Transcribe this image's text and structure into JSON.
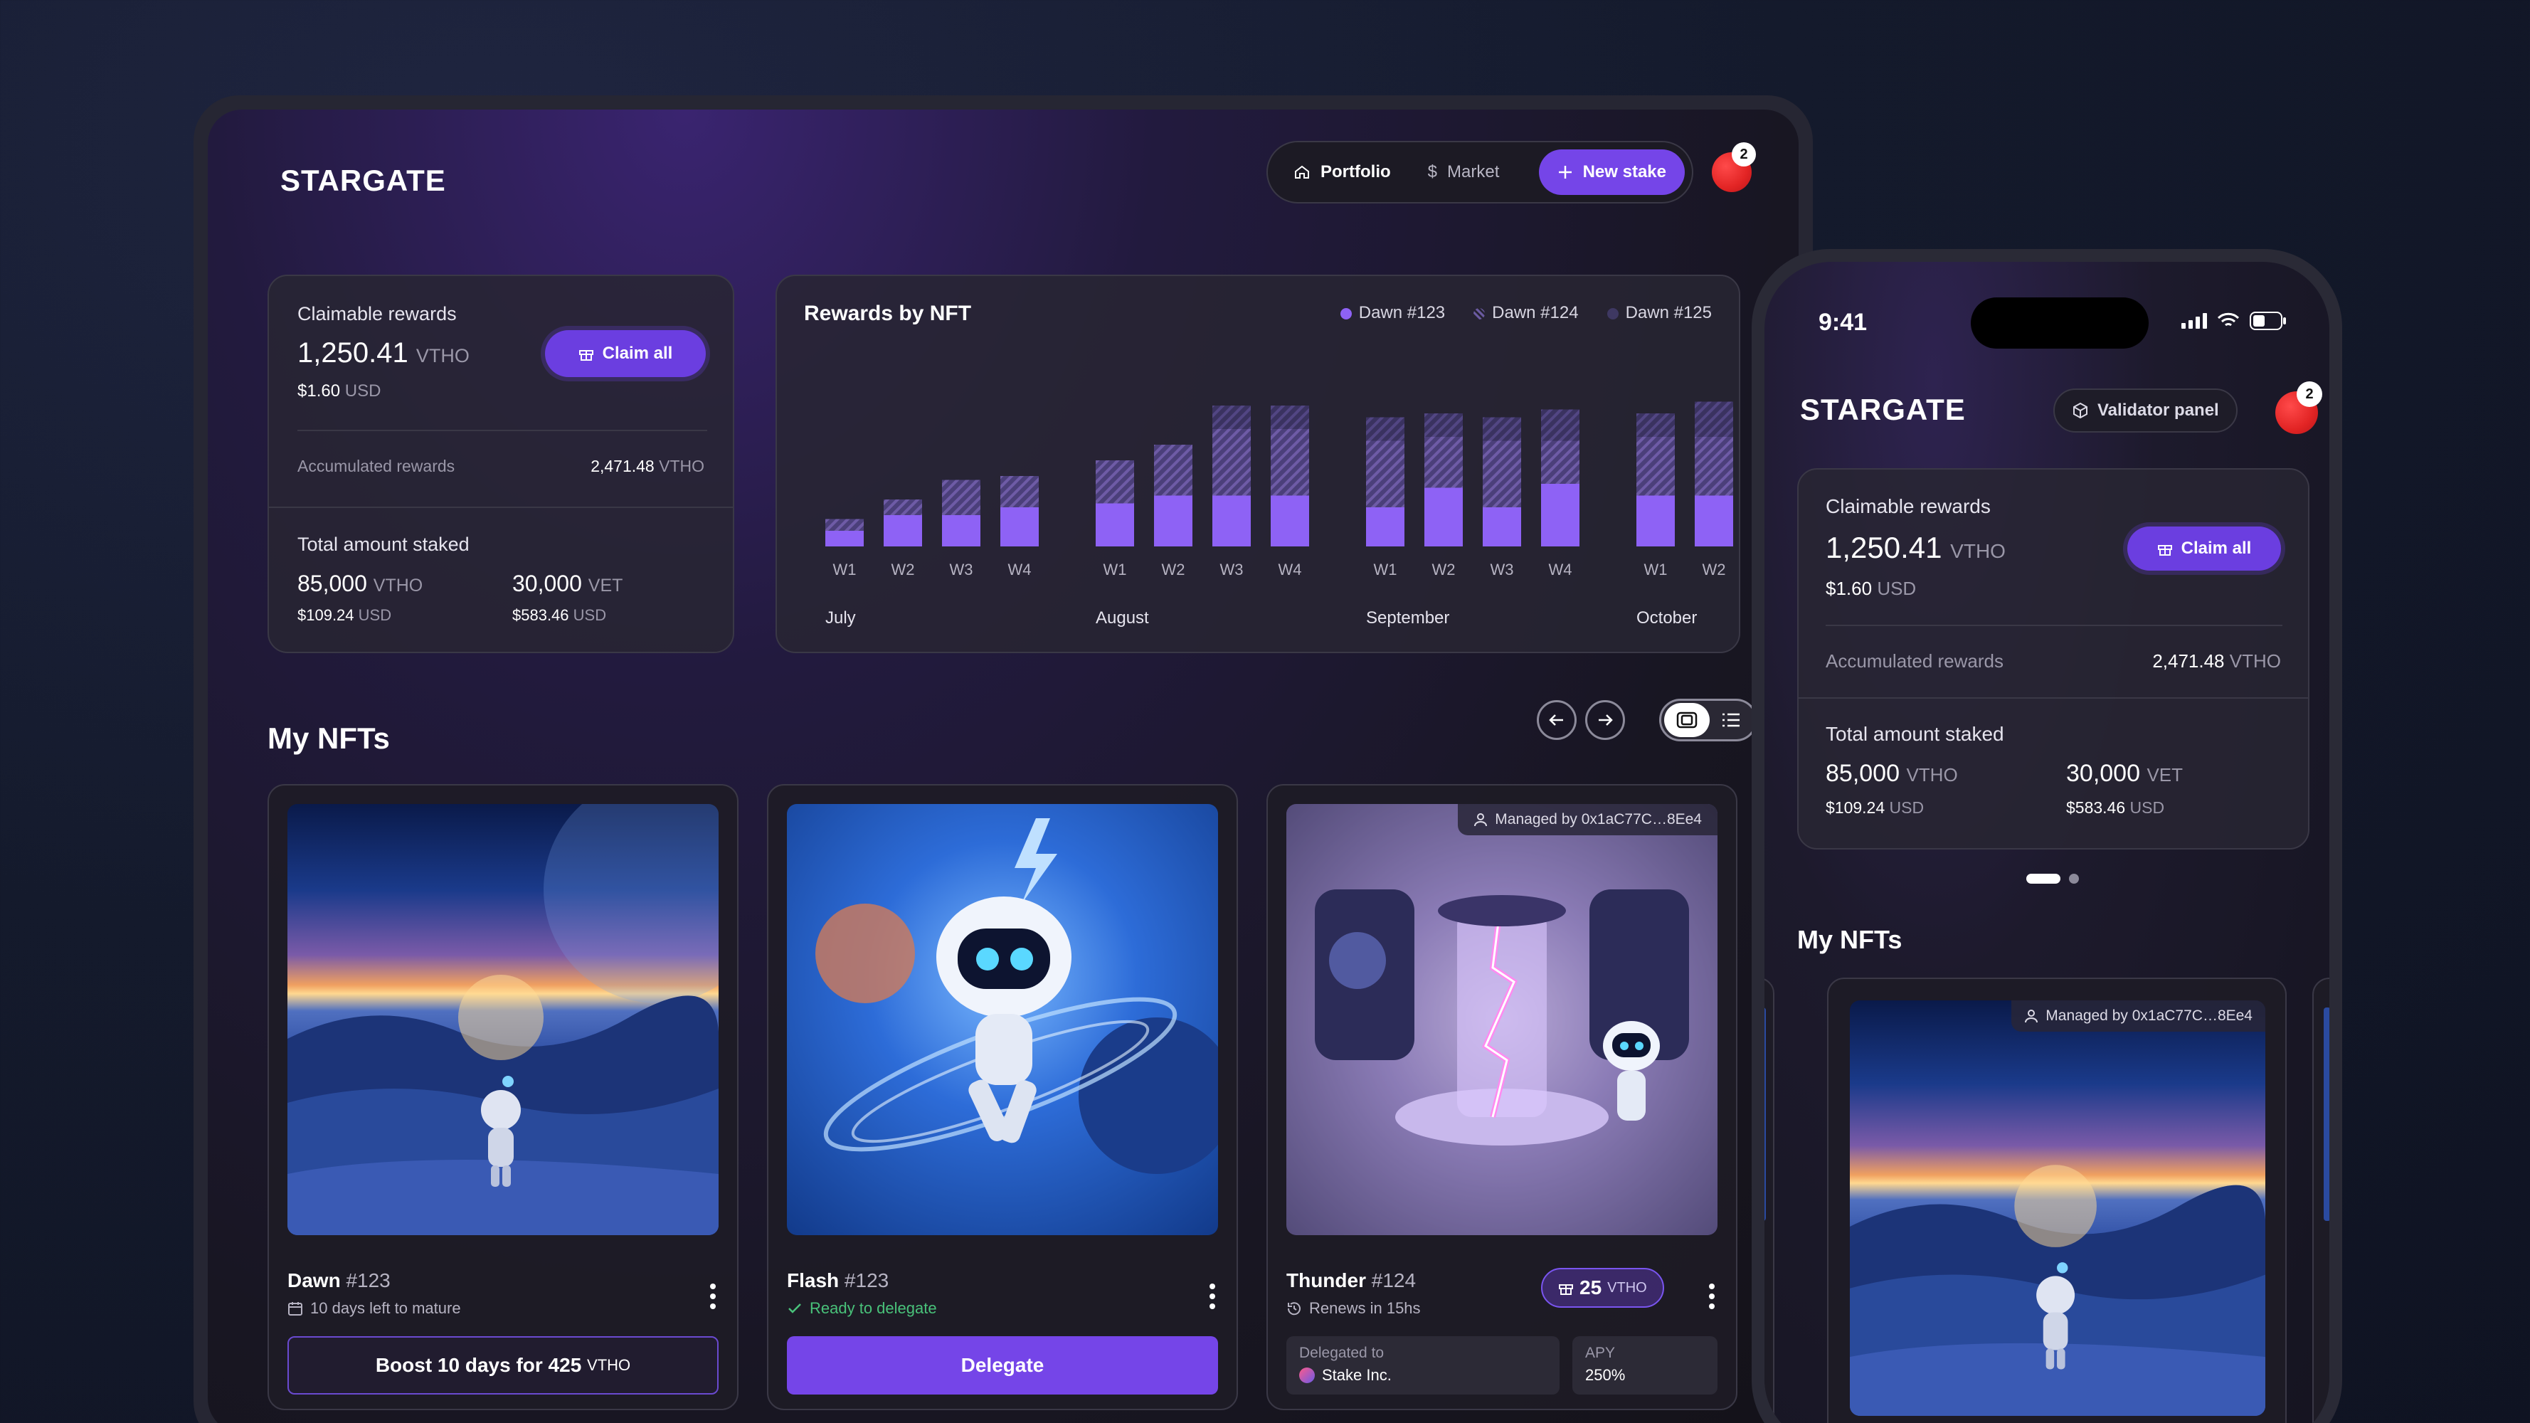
{
  "app": {
    "name": "STARGATE"
  },
  "nav": {
    "portfolio": "Portfolio",
    "market": "Market",
    "new_stake": "New stake",
    "notifications": "2"
  },
  "rewards": {
    "title": "Claimable rewards",
    "amount": "1,250.41",
    "unit": "VTHO",
    "usd_value": "$1.60",
    "usd_unit": "USD",
    "claim_label": "Claim all",
    "accumulated_label": "Accumulated rewards",
    "accumulated_value": "2,471.48",
    "accumulated_unit": "VTHO",
    "staked_title": "Total amount staked",
    "staked_vtho": "85,000",
    "staked_vtho_unit": "VTHO",
    "staked_vtho_usd": "$109.24",
    "staked_vet": "30,000",
    "staked_vet_unit": "VET",
    "staked_vet_usd": "$583.46",
    "usd": "USD"
  },
  "chart_data": {
    "type": "bar",
    "title": "Rewards by NFT",
    "legend": [
      "Dawn #123",
      "Dawn #124",
      "Dawn #125"
    ],
    "months": [
      "July",
      "August",
      "September",
      "October"
    ],
    "categories": [
      "W1",
      "W2",
      "W3",
      "W4",
      "W1",
      "W2",
      "W3",
      "W4",
      "W1",
      "W2",
      "W3",
      "W4",
      "W1",
      "W2"
    ],
    "month_of_category": [
      0,
      0,
      0,
      0,
      1,
      1,
      1,
      1,
      2,
      2,
      2,
      2,
      3,
      3
    ],
    "series": [
      {
        "name": "Dawn #123",
        "values": [
          20,
          40,
          40,
          50,
          55,
          65,
          65,
          65,
          50,
          75,
          50,
          80,
          65,
          65
        ]
      },
      {
        "name": "Dawn #124",
        "values": [
          15,
          20,
          45,
          40,
          55,
          65,
          85,
          85,
          85,
          65,
          85,
          55,
          75,
          75
        ]
      },
      {
        "name": "Dawn #125",
        "values": [
          0,
          0,
          0,
          0,
          0,
          0,
          30,
          30,
          30,
          30,
          30,
          40,
          30,
          45
        ]
      }
    ],
    "colors": {
      "solid": "#8e62f5",
      "hatch": "#5a4a8a"
    },
    "ylim": [
      0,
      200
    ]
  },
  "nfts": {
    "title": "My NFTs",
    "items": [
      {
        "name": "Dawn",
        "num": "#123",
        "sub": "10 days left to mature",
        "action_pre": "Boost 10 days for 425",
        "action_unit": "VTHO"
      },
      {
        "name": "Flash",
        "num": "#123",
        "sub": "Ready to delegate",
        "action": "Delegate"
      },
      {
        "name": "Thunder",
        "num": "#124",
        "sub": "Renews in 15hs",
        "managed": "Managed by 0x1aC77C…8Ee4",
        "reward": "25",
        "reward_unit": "VTHO",
        "delegated_label": "Delegated to",
        "delegated_value": "Stake Inc.",
        "apy_label": "APY",
        "apy_value": "250%"
      }
    ]
  },
  "phone": {
    "time": "9:41",
    "validator": "Validator panel",
    "managed": "Managed by 0x1aC77C…8Ee4"
  }
}
